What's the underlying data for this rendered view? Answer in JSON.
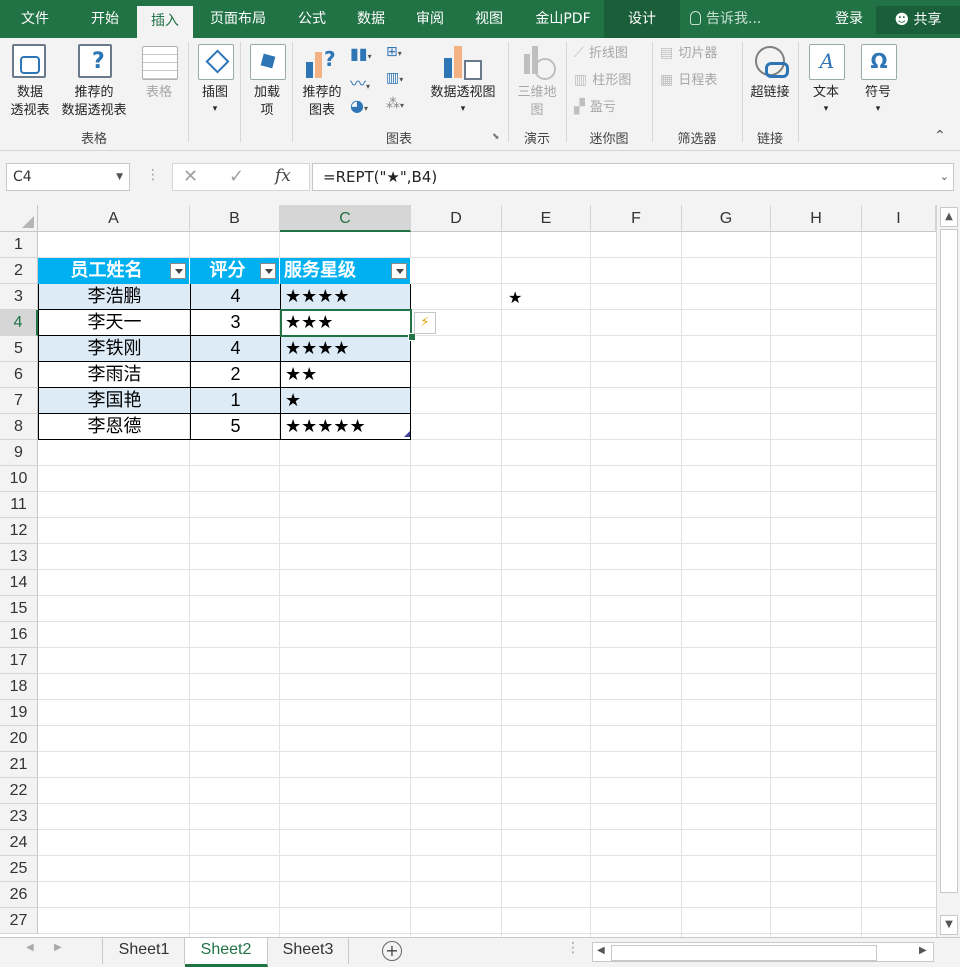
{
  "menu": {
    "tabs": [
      "文件",
      "开始",
      "插入",
      "页面布局",
      "公式",
      "数据",
      "审阅",
      "视图",
      "金山PDF",
      "设计"
    ],
    "active": "插入",
    "tell_me": "告诉我...",
    "login": "登录",
    "share": "共享"
  },
  "ribbon": {
    "pivot_table": [
      "数据",
      "透视表"
    ],
    "recommended_pivot": [
      "推荐的",
      "数据透视表"
    ],
    "table": "表格",
    "illustrations": "插图",
    "addins": [
      "加载",
      "项"
    ],
    "recommended_charts": [
      "推荐的",
      "图表"
    ],
    "pivot_chart": "数据透视图",
    "map3d": [
      "三维地",
      "图"
    ],
    "sparkline_line": "折线图",
    "sparkline_column": "柱形图",
    "sparkline_winloss": "盈亏",
    "slicer": "切片器",
    "timeline": "日程表",
    "hyperlink": "超链接",
    "text": "文本",
    "symbol": "符号",
    "groups": {
      "tables": "表格",
      "charts": "图表",
      "tours": "演示",
      "sparklines": "迷你图",
      "filters": "筛选器",
      "links": "链接"
    }
  },
  "formula_bar": {
    "name_box": "C4",
    "formula": "=REPT(\"★\",B4)"
  },
  "columns": [
    "A",
    "B",
    "C",
    "D",
    "E",
    "F",
    "G",
    "H",
    "I"
  ],
  "rows": [
    "1",
    "2",
    "3",
    "4",
    "5",
    "6",
    "7",
    "8",
    "9",
    "10",
    "11",
    "12",
    "13",
    "14",
    "15",
    "16",
    "17",
    "18",
    "19",
    "20",
    "21",
    "22",
    "23",
    "24",
    "25",
    "26",
    "27"
  ],
  "table": {
    "headers": [
      "员工姓名",
      "评分",
      "服务星级"
    ],
    "rows": [
      [
        "李浩鹏",
        "4",
        "★★★★"
      ],
      [
        "李天一",
        "3",
        "★★★"
      ],
      [
        "李铁刚",
        "4",
        "★★★★"
      ],
      [
        "李雨洁",
        "2",
        "★★"
      ],
      [
        "李国艳",
        "1",
        "★"
      ],
      [
        "李恩德",
        "5",
        "★★★★★"
      ]
    ]
  },
  "e3_value": "★",
  "sheets": [
    "Sheet1",
    "Sheet2",
    "Sheet3"
  ],
  "active_sheet": "Sheet2",
  "colors": {
    "excel_green": "#217346",
    "table_header": "#00b0f0",
    "band": "#ddebf7"
  }
}
